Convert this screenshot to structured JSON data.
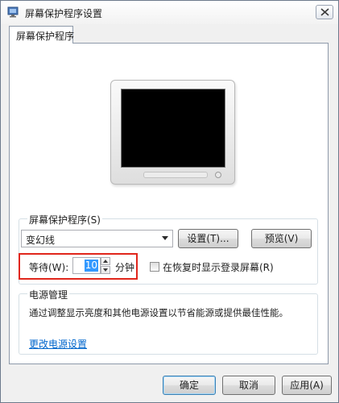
{
  "window": {
    "title": "屏幕保护程序设置",
    "close_label": "close"
  },
  "tab": {
    "label": "屏幕保护程序"
  },
  "screensaver_group": {
    "legend": "屏幕保护程序(S)",
    "selected": "变幻线",
    "settings_button": "设置(T)...",
    "preview_button": "预览(V)",
    "wait_label": "等待(W):",
    "wait_value": "10",
    "minutes_label": "分钟",
    "resume_logon_label": "在恢复时显示登录屏幕(R)",
    "resume_logon_checked": false
  },
  "power_group": {
    "legend": "电源管理",
    "description": "通过调整显示亮度和其他电源设置以节省能源或提供最佳性能。",
    "link": "更改电源设置"
  },
  "footer": {
    "ok_button": "确定",
    "cancel_button": "取消",
    "apply_button": "应用(A)"
  },
  "colors": {
    "highlight": "#e0261c",
    "link": "#0066cc",
    "selection": "#3399ff"
  }
}
